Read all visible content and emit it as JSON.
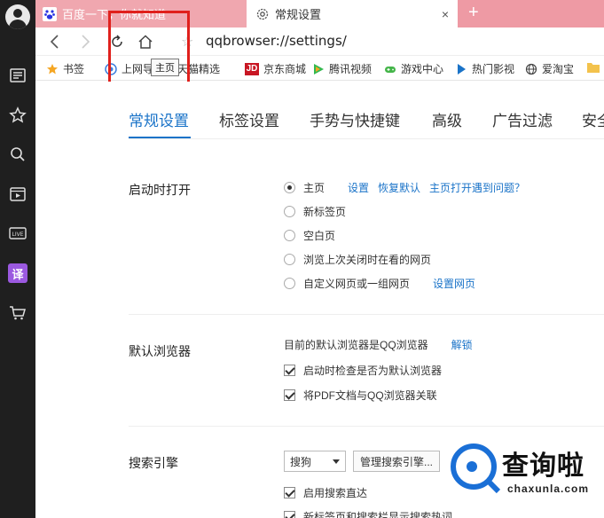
{
  "tabs": [
    {
      "title": "百度一下，你就知道"
    },
    {
      "title": "常规设置",
      "close": "×"
    }
  ],
  "new_tab_symbol": "+",
  "address": {
    "url": "qqbrowser://settings/"
  },
  "tooltip": "主页",
  "bookmarks": [
    {
      "label": "书签",
      "icon": "star-icon",
      "color": "#f5a623"
    },
    {
      "label": "上网导航",
      "icon": "navigation-icon",
      "color": "#3b7ddd"
    },
    {
      "label": "天猫精选",
      "icon": "tmall-icon",
      "color": "#e1251b"
    },
    {
      "label": "京东商城",
      "icon": "jd-icon",
      "color": "#c81623",
      "badge": "JD"
    },
    {
      "label": "腾讯视频",
      "icon": "tencent-video-icon",
      "color": "#33b94f"
    },
    {
      "label": "游戏中心",
      "icon": "gamepad-icon",
      "color": "#44b549"
    },
    {
      "label": "热门影视",
      "icon": "play-icon",
      "color": "#1a73c8"
    },
    {
      "label": "爱淘宝",
      "icon": "globe-icon",
      "color": "#444444"
    }
  ],
  "sidebar": {
    "translate_label": "译"
  },
  "settings_tabs": [
    {
      "label": "常规设置",
      "active": true
    },
    {
      "label": "标签设置"
    },
    {
      "label": "手势与快捷键"
    },
    {
      "label": "高级"
    },
    {
      "label": "广告过滤"
    },
    {
      "label": "安全"
    }
  ],
  "startup": {
    "title": "启动时打开",
    "options": [
      {
        "label": "主页",
        "checked": true
      },
      {
        "label": "新标签页"
      },
      {
        "label": "空白页"
      },
      {
        "label": "浏览上次关闭时在看的网页"
      },
      {
        "label": "自定义网页或一组网页"
      }
    ],
    "links": {
      "settings": "设置",
      "restore_default": "恢复默认",
      "homepage_problem": "主页打开遇到问题？",
      "set_pages": "设置网页"
    }
  },
  "default_browser": {
    "title": "默认浏览器",
    "status": "目前的默认浏览器是QQ浏览器",
    "unlock": "解锁",
    "check_on_start": "启动时检查是否为默认浏览器",
    "pdf_assoc": "将PDF文档与QQ浏览器关联"
  },
  "search": {
    "title": "搜索引擎",
    "engine": "搜狗",
    "manage": "管理搜索引擎...",
    "enable_direct": "启用搜索直达",
    "newtab_hot": "新标签页和搜索栏显示搜索热词"
  },
  "watermark": {
    "text": "查询啦",
    "url": "chaxunla.com"
  },
  "colors": {
    "accent": "#1a73c8",
    "highlight": "#e0201c",
    "tabstrip": "#ee9aa4"
  }
}
